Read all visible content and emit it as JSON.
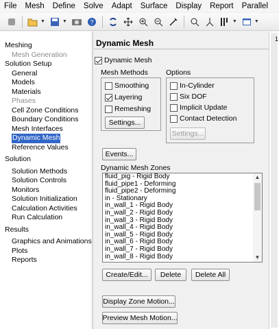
{
  "menu": [
    "File",
    "Mesh",
    "Define",
    "Solve",
    "Adapt",
    "Surface",
    "Display",
    "Report",
    "Parallel"
  ],
  "toolbar": {
    "icons": [
      "stop-icon",
      "open-icon",
      "save-icon",
      "capture-icon",
      "help-icon",
      "rotate-icon",
      "pan-icon",
      "zoom-in-icon",
      "zoom-box-icon",
      "probe-icon",
      "zoom-fit-icon",
      "axes-icon",
      "layout-icon",
      "window-icon"
    ]
  },
  "tree": {
    "items": [
      {
        "label": "Meshing",
        "level": 0
      },
      {
        "label": "Mesh Generation",
        "level": 1,
        "grey": true
      },
      {
        "label": "Solution Setup",
        "level": 0
      },
      {
        "label": "General",
        "level": 1
      },
      {
        "label": "Models",
        "level": 1
      },
      {
        "label": "Materials",
        "level": 1
      },
      {
        "label": "Phases",
        "level": 1,
        "grey": true
      },
      {
        "label": "Cell Zone Conditions",
        "level": 1
      },
      {
        "label": "Boundary Conditions",
        "level": 1
      },
      {
        "label": "Mesh Interfaces",
        "level": 1
      },
      {
        "label": "Dynamic Mesh",
        "level": 1,
        "selected": true
      },
      {
        "label": "Reference Values",
        "level": 1
      },
      {
        "label": "Solution",
        "level": 0
      },
      {
        "label": "Solution Methods",
        "level": 1
      },
      {
        "label": "Solution Controls",
        "level": 1
      },
      {
        "label": "Monitors",
        "level": 1
      },
      {
        "label": "Solution Initialization",
        "level": 1
      },
      {
        "label": "Calculation Activities",
        "level": 1
      },
      {
        "label": "Run Calculation",
        "level": 1
      },
      {
        "label": "Results",
        "level": 0
      },
      {
        "label": "Graphics and Animations",
        "level": 1
      },
      {
        "label": "Plots",
        "level": 1
      },
      {
        "label": "Reports",
        "level": 1
      }
    ]
  },
  "panel": {
    "title": "Dynamic Mesh",
    "dynamic_mesh": {
      "label": "Dynamic Mesh",
      "checked": true
    },
    "mesh_methods": {
      "title": "Mesh Methods",
      "items": [
        {
          "label": "Smoothing",
          "checked": false
        },
        {
          "label": "Layering",
          "checked": true
        },
        {
          "label": "Remeshing",
          "checked": false
        }
      ],
      "settings_label": "Settings..."
    },
    "options": {
      "title": "Options",
      "items": [
        {
          "label": "In-Cylinder",
          "checked": false
        },
        {
          "label": "Six DOF",
          "checked": false
        },
        {
          "label": "Implicit Update",
          "checked": false
        },
        {
          "label": "Contact Detection",
          "checked": false
        }
      ],
      "settings_label": "Settings..."
    },
    "events_label": "Events...",
    "zones_title": "Dynamic Mesh Zones",
    "zones": [
      "fluid_pig - Rigid Body",
      "fluid_pipe1 - Deforming",
      "fluid_pipe2 - Deforming",
      "in - Stationary",
      "in_wall_1 - Rigid Body",
      "in_wall_2 - Rigid Body",
      "in_wall_3 - Rigid Body",
      "in_wall_4 - Rigid Body",
      "in_wall_5 - Rigid Body",
      "in_wall_6 - Rigid Body",
      "in_wall_7 - Rigid Body",
      "in_wall_8 - Rigid Body"
    ],
    "create_edit_label": "Create/Edit...",
    "delete_label": "Delete",
    "delete_all_label": "Delete All",
    "display_zone_motion_label": "Display Zone Motion...",
    "preview_mesh_motion_label": "Preview Mesh Motion..."
  },
  "right_strip": {
    "number": "1"
  }
}
